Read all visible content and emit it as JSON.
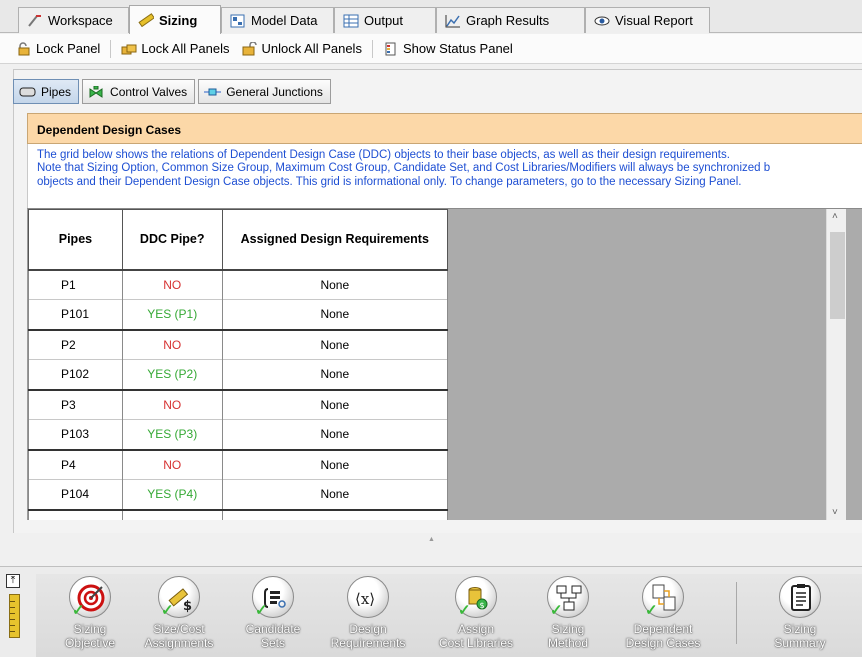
{
  "tabs": [
    {
      "label": "Workspace",
      "icon": "workspace-icon"
    },
    {
      "label": "Sizing",
      "icon": "ruler-icon",
      "active": true
    },
    {
      "label": "Model Data",
      "icon": "model-data-icon"
    },
    {
      "label": "Output",
      "icon": "output-table-icon"
    },
    {
      "label": "Graph Results",
      "icon": "graph-icon"
    },
    {
      "label": "Visual Report",
      "icon": "eye-icon"
    }
  ],
  "toolbar": {
    "lock_panel": "Lock Panel",
    "lock_all_panels": "Lock All Panels",
    "unlock_all_panels": "Unlock All Panels",
    "show_status_panel": "Show Status Panel"
  },
  "subtabs": [
    {
      "label": "Pipes",
      "icon": "pipe-icon",
      "active": true
    },
    {
      "label": "Control Valves",
      "icon": "control-valve-icon"
    },
    {
      "label": "General Junctions",
      "icon": "general-junction-icon"
    }
  ],
  "section": {
    "title": "Dependent Design Cases",
    "info_lines": [
      "The grid below shows the relations of Dependent Design Case (DDC) objects to their base objects, as well as their design requirements.",
      "Note that Sizing Option, Common Size Group, Maximum Cost Group, Candidate Set, and Cost Libraries/Modifiers will always be synchronized b",
      "objects and their Dependent Design Case objects. This grid is informational only. To change parameters, go to the necessary Sizing Panel."
    ]
  },
  "grid": {
    "headers": [
      "Pipes",
      "DDC Pipe?",
      "Assigned Design Requirements"
    ],
    "rows": [
      {
        "pipe": "P1",
        "ddc": "NO",
        "req": "None",
        "status": "no"
      },
      {
        "pipe": "P101",
        "ddc": "YES (P1)",
        "req": "None",
        "status": "yes"
      },
      {
        "pipe": "P2",
        "ddc": "NO",
        "req": "None",
        "status": "no"
      },
      {
        "pipe": "P102",
        "ddc": "YES (P2)",
        "req": "None",
        "status": "yes"
      },
      {
        "pipe": "P3",
        "ddc": "NO",
        "req": "None",
        "status": "no"
      },
      {
        "pipe": "P103",
        "ddc": "YES (P3)",
        "req": "None",
        "status": "yes"
      },
      {
        "pipe": "P4",
        "ddc": "NO",
        "req": "None",
        "status": "no"
      },
      {
        "pipe": "P104",
        "ddc": "YES (P4)",
        "req": "None",
        "status": "yes"
      }
    ]
  },
  "colors": {
    "no": "#d63232",
    "yes": "#34a834",
    "info_text": "#1e4fd3",
    "header_band": "#fcd8a8"
  },
  "nav": [
    {
      "label1": "Sizing",
      "label2": "Objective",
      "icon": "target-icon"
    },
    {
      "label1": "Size/Cost",
      "label2": "Assignments",
      "icon": "size-cost-icon"
    },
    {
      "label1": "Candidate",
      "label2": "Sets",
      "icon": "candidate-sets-icon"
    },
    {
      "label1": "Design",
      "label2": "Requirements",
      "icon": "design-requirements-icon"
    },
    {
      "label1": "Assign",
      "label2": "Cost Libraries",
      "icon": "cost-library-icon"
    },
    {
      "label1": "Sizing",
      "label2": "Method",
      "icon": "sizing-method-icon"
    },
    {
      "label1": "Dependent",
      "label2": "Design Cases",
      "icon": "dependent-design-cases-icon"
    },
    {
      "label1": "Sizing",
      "label2": "Summary",
      "icon": "clipboard-icon"
    }
  ]
}
